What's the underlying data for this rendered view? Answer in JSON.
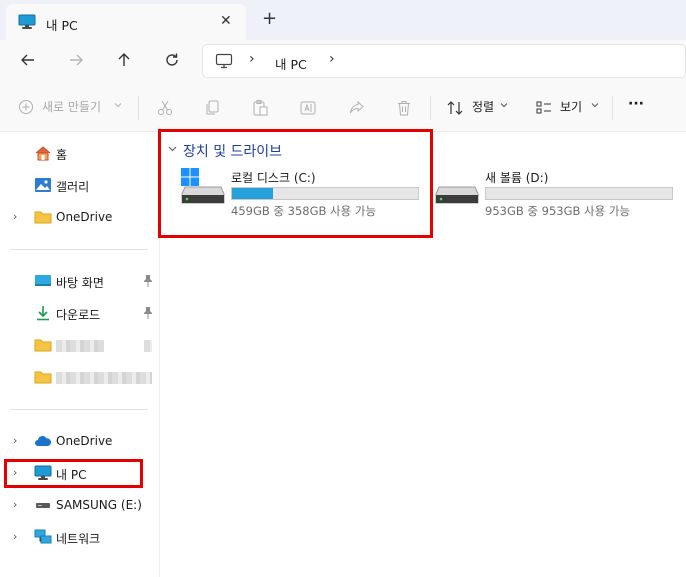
{
  "tab": {
    "title": "내 PC",
    "close_glyph": "✕",
    "new_glyph": "+"
  },
  "address": {
    "current": "내 PC",
    "separator": "›"
  },
  "commands": {
    "new_label": "새로 만들기",
    "sort_label": "정렬",
    "view_label": "보기",
    "more_label": "···"
  },
  "sidebar": {
    "quick": [
      {
        "label": "홈",
        "icon": "home-icon"
      },
      {
        "label": "갤러리",
        "icon": "gallery-icon"
      },
      {
        "label": "OneDrive",
        "icon": "folder-icon"
      }
    ],
    "pinned": [
      {
        "label": "바탕 화면",
        "icon": "desktop-icon",
        "pinned": true
      },
      {
        "label": "다운로드",
        "icon": "download-icon",
        "pinned": true
      }
    ],
    "locations": [
      {
        "label": "OneDrive",
        "icon": "cloud-icon"
      },
      {
        "label": "내 PC",
        "icon": "pc-icon"
      },
      {
        "label": "SAMSUNG (E:)",
        "icon": "usb-drive-icon"
      },
      {
        "label": "네트워크",
        "icon": "network-icon"
      }
    ]
  },
  "main": {
    "group_title": "장치 및 드라이브",
    "drives": [
      {
        "name": "로컬 디스크 (C:)",
        "info": "459GB 중 358GB 사용 가능",
        "used_fraction": 0.22,
        "system": true
      },
      {
        "name": "새 볼륨 (D:)",
        "info": "953GB 중 953GB 사용 가능",
        "used_fraction": 0.0,
        "system": false
      }
    ]
  },
  "colors": {
    "accent": "#26a0da",
    "highlight": "#e60000",
    "group_title": "#1c3fa0"
  }
}
